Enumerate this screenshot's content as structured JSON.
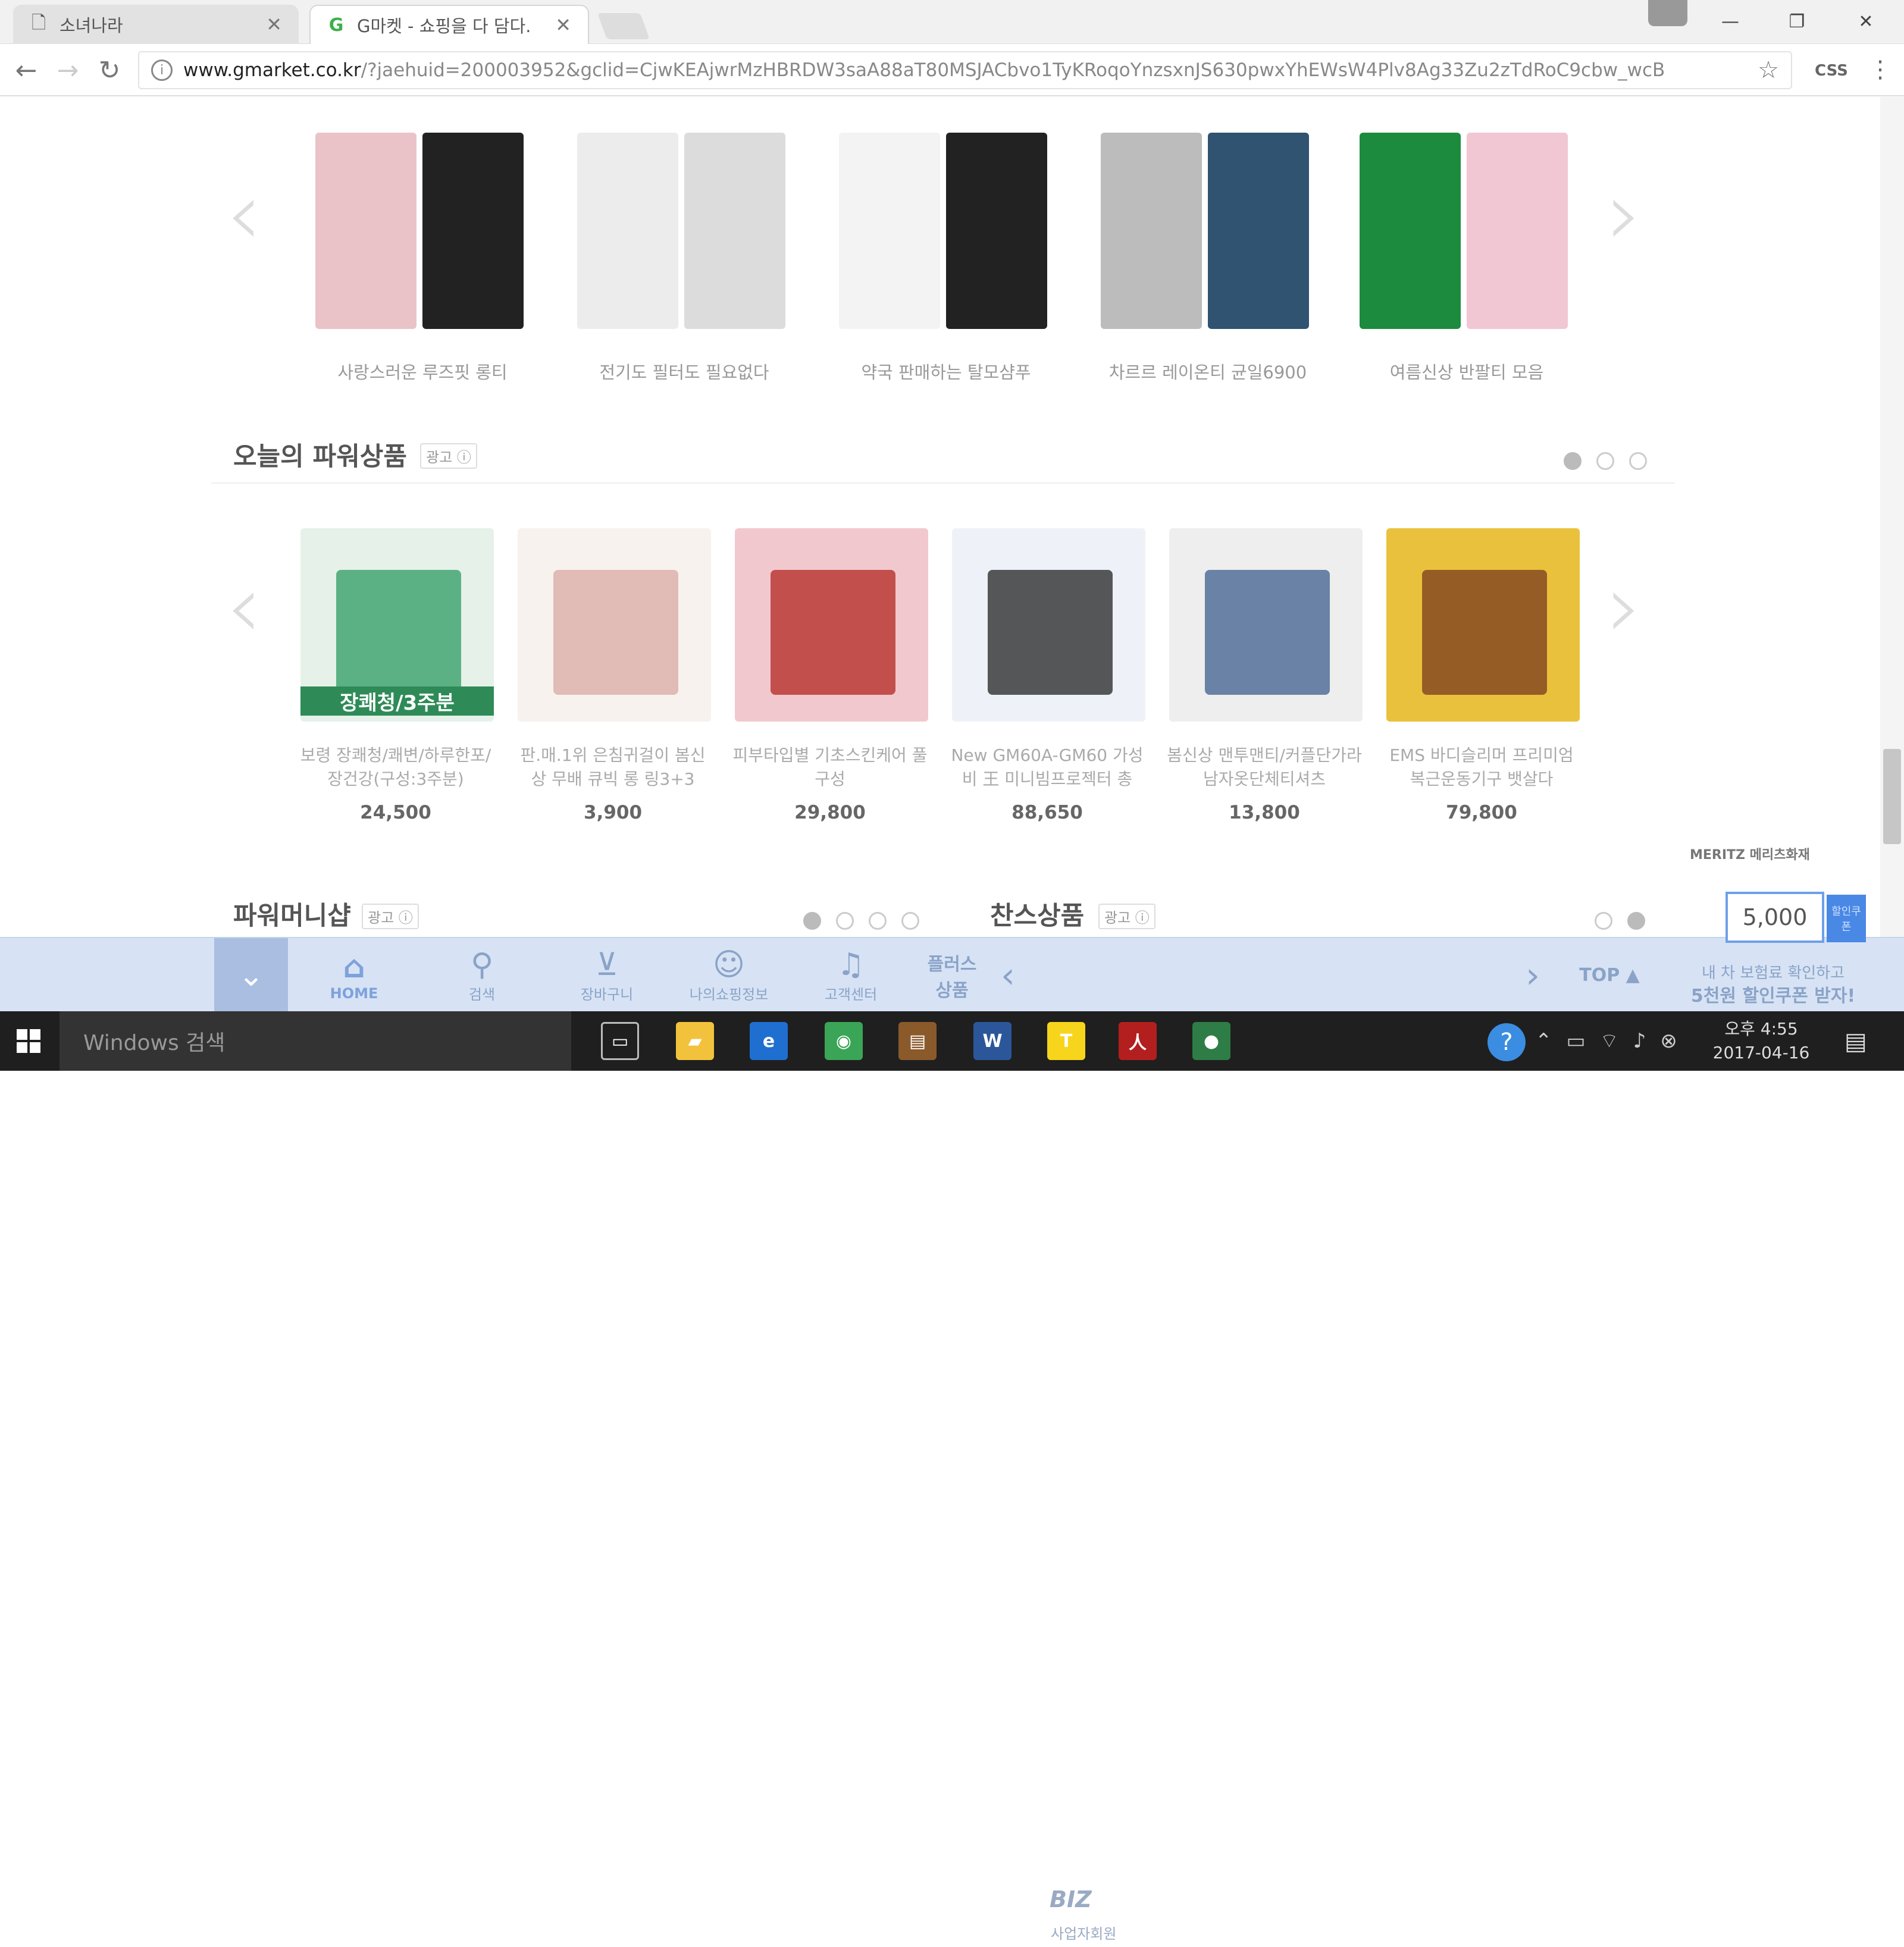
{
  "tabs": [
    {
      "title": "소녀나라",
      "active": false
    },
    {
      "title": "G마켓 - 쇼핑을 다 담다.",
      "active": true
    }
  ],
  "window": {
    "minimize": "—",
    "restore": "❐",
    "close": "✕"
  },
  "address": {
    "domain": "www.gmarket.co.kr",
    "path": "/?jaehuid=200003952&gclid=CjwKEAjwrMzHBRDW3saA88aT80MSJACbvo1TyKRoqoYnzsxnJS630pwxYhEWsW4Plv8Ag33Zu2zTdRoC9cbw_wcB",
    "extension": "CSS"
  },
  "top_carousel": {
    "items": [
      {
        "caption": "사랑스러운 루즈핏 롱티",
        "colors": [
          "#e9c3c8",
          "#222222"
        ]
      },
      {
        "caption": "전기도 필터도 필요없다",
        "colors": [
          "#ececec",
          "#dcdcdc"
        ]
      },
      {
        "caption": "약국 판매하는 탈모샴푸",
        "colors": [
          "#f3f3f3",
          "#222222"
        ]
      },
      {
        "caption": "차르르 레이온티 균일6900",
        "colors": [
          "#bcbcbc",
          "#2f5370"
        ]
      },
      {
        "caption": "여름신상 반팔티 모음",
        "colors": [
          "#1c8b3e",
          "#f0c7d2"
        ]
      }
    ]
  },
  "power_products": {
    "title": "오늘의 파워상품",
    "ad_label": "광고",
    "info_icon": "ⓘ",
    "pages_active": 0,
    "pages_count": 3,
    "items": [
      {
        "name": "보령 장쾌청/쾌변/하루한포/장건강(구성:3주분)",
        "price": "24,500",
        "overlay": "장쾌청/3주분",
        "bg": "#e6f1e9",
        "accent": "#2e9b62"
      },
      {
        "name": "판.매.1위 은침귀걸이 봄신상 무배 큐빅 롱 링3+3",
        "price": "3,900",
        "overlay": "",
        "bg": "#f7f2ee",
        "accent": "#d9a8a3"
      },
      {
        "name": "피부타입별 기초스킨케어 풀 구성",
        "price": "29,800",
        "overlay": "",
        "bg": "#f2c8cf",
        "accent": "#b2271f"
      },
      {
        "name": "New GM60A-GM60 가성비 王 미니빔프로젝터 총",
        "price": "88,650",
        "overlay": "",
        "bg": "#eef2f8",
        "accent": "#222222"
      },
      {
        "name": "봄신상 맨투맨티/커플단가라남자옷단체티셔츠",
        "price": "13,800",
        "overlay": "",
        "bg": "#eeeeee",
        "accent": "#3e5d8c"
      },
      {
        "name": "EMS 바디슬리머 프리미엄 복근운동기구 뱃살다",
        "price": "79,800",
        "overlay": "",
        "bg": "#e9c13c",
        "accent": "#7a3a1e"
      }
    ]
  },
  "power_money": {
    "title": "파워머니샵",
    "ad_label": "광고",
    "pages_count": 4,
    "pages_active": 0
  },
  "chance": {
    "title": "찬스상품",
    "ad_label": "광고",
    "pages_count": 2,
    "pages_active": 1
  },
  "meritz": {
    "label": "MERITZ 메리츠화재"
  },
  "coupon": {
    "value": "5,000",
    "button": "할인쿠폰",
    "text1": "내 차 보험료 확인하고",
    "text2": "5천원 할인쿠폰 받자!"
  },
  "bottom_nav": {
    "home": "HOME",
    "search": "검색",
    "cart": "장바구니",
    "myshopping": "나의쇼핑정보",
    "cs": "고객센터",
    "plus": "플러스 상품",
    "biz_logo": "BIZ",
    "biz_caption": "사업자회원",
    "top": "TOP ▲"
  },
  "taskbar": {
    "search_placeholder": "Windows 검색",
    "clock_time": "오후 4:55",
    "clock_date": "2017-04-16",
    "apps": [
      {
        "name": "task-view",
        "color": "#1f1f1f",
        "glyph": "▭"
      },
      {
        "name": "file-explorer",
        "color": "#f3c23d",
        "glyph": "▰"
      },
      {
        "name": "internet-explorer",
        "color": "#1f6fd1",
        "glyph": "e"
      },
      {
        "name": "chrome",
        "color": "#3aa557",
        "glyph": "◉"
      },
      {
        "name": "app-brown",
        "color": "#8a5a2b",
        "glyph": "▤"
      },
      {
        "name": "word",
        "color": "#2b579a",
        "glyph": "W"
      },
      {
        "name": "talk",
        "color": "#f7d51c",
        "glyph": "T"
      },
      {
        "name": "acrobat",
        "color": "#b31f1f",
        "glyph": "人"
      },
      {
        "name": "app-green",
        "color": "#2e7d46",
        "glyph": "●"
      }
    ]
  }
}
